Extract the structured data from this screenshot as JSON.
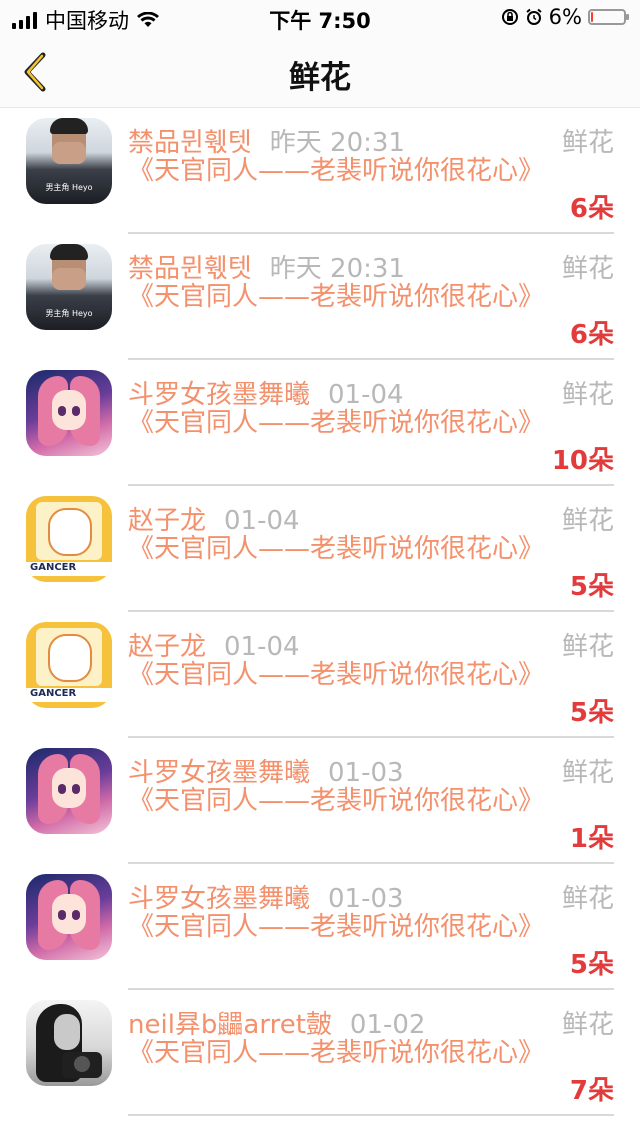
{
  "status_bar": {
    "carrier": "中国移动",
    "time": "下午 7:50",
    "battery": "6%",
    "battery_level": 0.06,
    "battery_color": "#ff3b30"
  },
  "nav": {
    "back_icon": "chevron-left-icon",
    "title": "鲜花"
  },
  "colors": {
    "accent": "#f4916d",
    "count": "#e23b3b",
    "muted": "#b8b8b8"
  },
  "rows": [
    {
      "name": "禁品뮌훿텟",
      "time": "昨天 20:31",
      "tag": "鲜花",
      "title": "《天官同人——老裴听说你很花心》",
      "count": "6朵",
      "avatar": "boy"
    },
    {
      "name": "禁品뮌훿텟",
      "time": "昨天 20:31",
      "tag": "鲜花",
      "title": "《天官同人——老裴听说你很花心》",
      "count": "6朵",
      "avatar": "boy"
    },
    {
      "name": "斗罗女孩墨舞曦",
      "time": "01-04",
      "tag": "鲜花",
      "title": "《天官同人——老裴听说你很花心》",
      "count": "10朵",
      "avatar": "anime"
    },
    {
      "name": "赵子龙",
      "time": "01-04",
      "tag": "鲜花",
      "title": "《天官同人——老裴听说你很花心》",
      "count": "5朵",
      "avatar": "yellow"
    },
    {
      "name": "赵子龙",
      "time": "01-04",
      "tag": "鲜花",
      "title": "《天官同人——老裴听说你很花心》",
      "count": "5朵",
      "avatar": "yellow"
    },
    {
      "name": "斗罗女孩墨舞曦",
      "time": "01-03",
      "tag": "鲜花",
      "title": "《天官同人——老裴听说你很花心》",
      "count": "1朵",
      "avatar": "anime"
    },
    {
      "name": "斗罗女孩墨舞曦",
      "time": "01-03",
      "tag": "鲜花",
      "title": "《天官同人——老裴听说你很花心》",
      "count": "5朵",
      "avatar": "anime"
    },
    {
      "name": "neil昪b鼺arret皼",
      "time": "01-02",
      "tag": "鲜花",
      "title": "《天官同人——老裴听说你很花心》",
      "count": "7朵",
      "avatar": "photo"
    }
  ],
  "avatar_texts": {
    "boy": "男主角 Heyo",
    "yellow": "GANCER"
  }
}
